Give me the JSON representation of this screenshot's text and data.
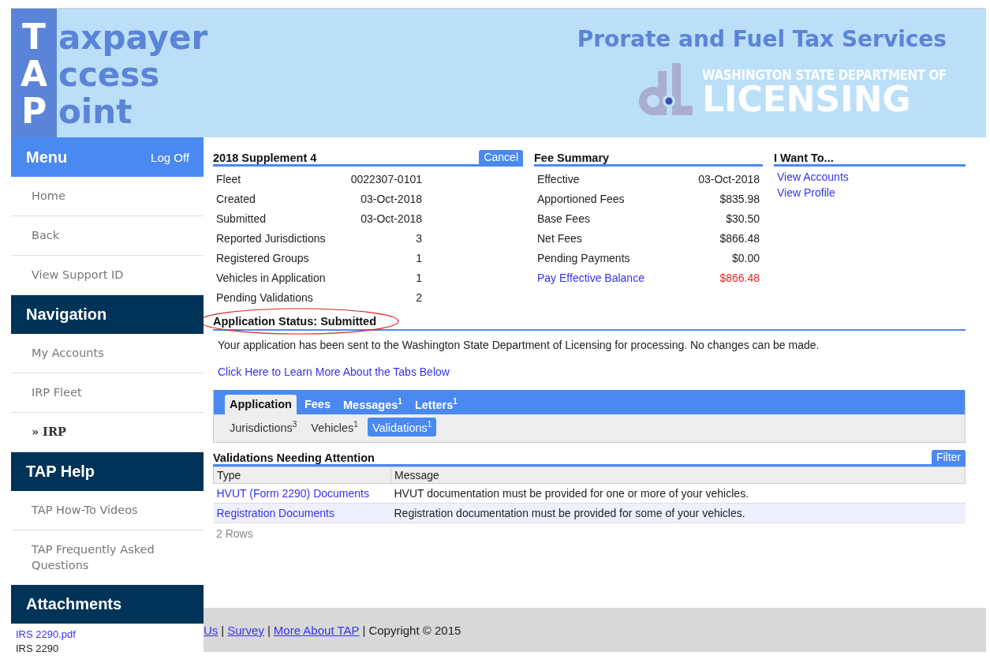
{
  "header": {
    "logo": [
      {
        "initial": "T",
        "rest": "axpayer"
      },
      {
        "initial": "A",
        "rest": "ccess"
      },
      {
        "initial": "P",
        "rest": "oint"
      }
    ],
    "service_title": "Prorate and Fuel Tax Services",
    "agency": {
      "line1": "WASHINGTON STATE DEPARTMENT OF",
      "line2": "LICENSING"
    }
  },
  "sidebar": {
    "sections": [
      {
        "kind": "menu",
        "title": "Menu",
        "action": "Log Off",
        "items": [
          {
            "label": "Home",
            "selected": false
          },
          {
            "label": "Back",
            "selected": false
          },
          {
            "label": "View Support ID",
            "selected": false
          }
        ]
      },
      {
        "kind": "section",
        "title": "Navigation",
        "items": [
          {
            "label": "My Accounts",
            "selected": false
          },
          {
            "label": "IRP Fleet",
            "selected": false
          },
          {
            "label": "» IRP",
            "selected": true
          }
        ]
      },
      {
        "kind": "section",
        "title": "TAP Help",
        "items": [
          {
            "label": "TAP How-To Videos",
            "selected": false
          },
          {
            "label": "TAP Frequently Asked Questions",
            "selected": false
          }
        ]
      },
      {
        "kind": "attachments",
        "title": "Attachments",
        "files": [
          {
            "link": "IRS 2290.pdf",
            "label": "IRS 2290"
          }
        ]
      }
    ]
  },
  "summary": {
    "title": "2018 Supplement 4",
    "cancel_button": "Cancel",
    "fields": [
      {
        "label": "Fleet",
        "value": "0022307-0101"
      },
      {
        "label": "Created",
        "value": "03-Oct-2018"
      },
      {
        "label": "Submitted",
        "value": "03-Oct-2018"
      },
      {
        "label": "Reported Jurisdictions",
        "value": "3"
      },
      {
        "label": "Registered Groups",
        "value": "1"
      },
      {
        "label": "Vehicles in Application",
        "value": "1"
      },
      {
        "label": "Pending Validations",
        "value": "2"
      }
    ]
  },
  "fee_summary": {
    "title": "Fee Summary",
    "rows": [
      {
        "kind": "plain",
        "label": "Effective",
        "value": "03-Oct-2018"
      },
      {
        "kind": "plain",
        "label": "Apportioned Fees",
        "value": "$835.98"
      },
      {
        "kind": "plain",
        "label": "Base Fees",
        "value": "$30.50"
      },
      {
        "kind": "plain",
        "label": "Net Fees",
        "value": "$866.48"
      },
      {
        "kind": "plain",
        "label": "Pending Payments",
        "value": "$0.00"
      },
      {
        "kind": "balance",
        "label": "Pay Effective Balance",
        "value": "$866.48"
      }
    ]
  },
  "i_want_to": {
    "title": "I Want To...",
    "links": [
      "View Accounts",
      "View Profile"
    ]
  },
  "status": {
    "heading": "Application Status: Submitted",
    "circled": true,
    "message": "Your application has been sent to the Washington State Department of Licensing for processing. No changes can be made.",
    "learn_more_link": "Click Here to Learn More About the Tabs Below"
  },
  "tabs": [
    {
      "label": "Application",
      "selected": true
    },
    {
      "label": "Fees",
      "selected": false
    },
    {
      "label": "Messages",
      "count": "1",
      "selected": false
    },
    {
      "label": "Letters",
      "count": "1",
      "selected": false
    }
  ],
  "subtabs": [
    {
      "label": "Jurisdictions",
      "count": "3",
      "selected": false
    },
    {
      "label": "Vehicles",
      "count": "1",
      "selected": false
    },
    {
      "label": "Validations",
      "count": "1",
      "selected": true
    }
  ],
  "validations": {
    "title": "Validations Needing Attention",
    "filter_button": "Filter",
    "columns": [
      "Type",
      "Message"
    ],
    "rows": [
      {
        "type": "HVUT (Form 2290) Documents",
        "message": "HVUT documentation must be provided for one or more of your vehicles."
      },
      {
        "type": "Registration Documents",
        "message": "Registration documentation must be provided for some of your vehicles."
      }
    ],
    "row_count": "2 Rows"
  },
  "footer": [
    {
      "kind": "link",
      "text": "Us"
    },
    {
      "kind": "separator",
      "text": "|"
    },
    {
      "kind": "link",
      "text": "Survey"
    },
    {
      "kind": "separator",
      "text": "|"
    },
    {
      "kind": "link",
      "text": "More About TAP"
    },
    {
      "kind": "separator",
      "text": "|"
    },
    {
      "kind": "text",
      "text": "Copyright © 2015"
    }
  ]
}
